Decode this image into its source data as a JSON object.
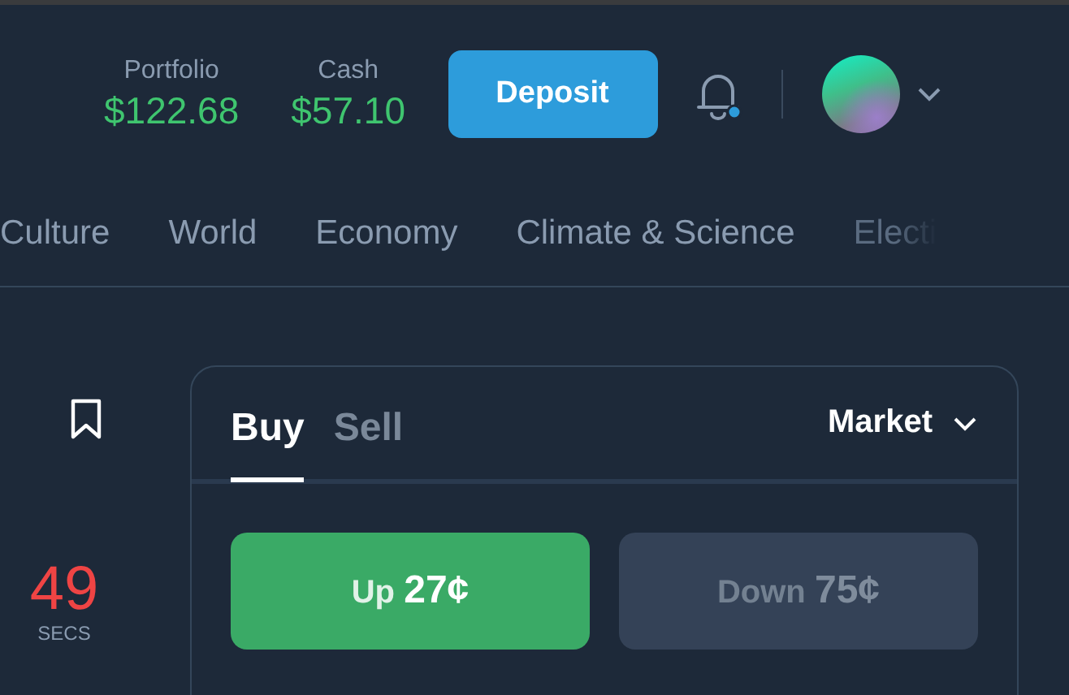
{
  "header": {
    "portfolio": {
      "label": "Portfolio",
      "value": "$122.68"
    },
    "cash": {
      "label": "Cash",
      "value": "$57.10"
    },
    "deposit_button": "Deposit",
    "notifications_unread": true
  },
  "categories": [
    {
      "label": "Culture",
      "faded": false
    },
    {
      "label": "World",
      "faded": false
    },
    {
      "label": "Economy",
      "faded": false
    },
    {
      "label": "Climate & Science",
      "faded": false
    },
    {
      "label": "Electi",
      "faded": true
    }
  ],
  "timer": {
    "value": "49",
    "unit": "SECS"
  },
  "trade": {
    "tabs": [
      {
        "label": "Buy",
        "selected": true
      },
      {
        "label": "Sell",
        "selected": false
      }
    ],
    "order_type": "Market",
    "outcomes": [
      {
        "label": "Up",
        "price": "27¢",
        "selected": true
      },
      {
        "label": "Down",
        "price": "75¢",
        "selected": false
      }
    ]
  }
}
